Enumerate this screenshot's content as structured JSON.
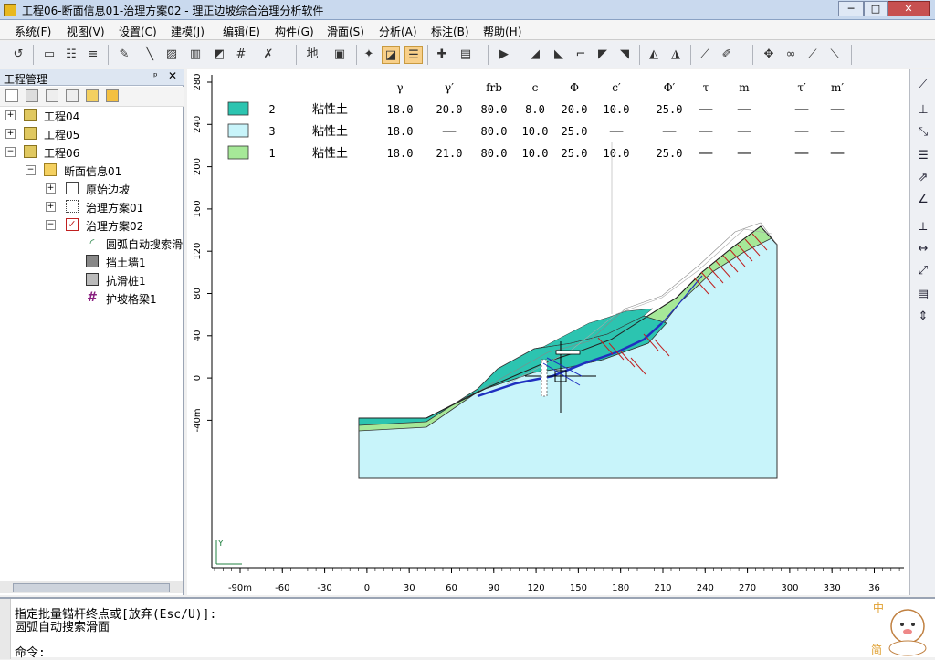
{
  "window": {
    "title": "工程06-断面信息01-治理方案02 - 理正边坡综合治理分析软件",
    "min": "─",
    "max": "□",
    "close": "✕"
  },
  "menus": [
    "系统(F)",
    "视图(V)",
    "设置(C)",
    "建模(J)",
    "编辑(E)",
    "构件(G)",
    "滑面(S)",
    "分析(A)",
    "标注(B)",
    "帮助(H)"
  ],
  "toolbar_label": "地",
  "panel": {
    "title": "工程管理",
    "pin": "ᵖ",
    "close": "✕"
  },
  "tree": {
    "p04": "工程04",
    "p05": "工程05",
    "p06": "工程06",
    "sec": "断面信息01",
    "orig": "原始边坡",
    "plan1": "治理方案01",
    "plan2": "治理方案02",
    "arc": "圆弧自动搜索滑",
    "wall": "挡土墙1",
    "pile": "抗滑桩1",
    "beam": "护坡格梁1"
  },
  "icons": {
    "expand": "plus-box-icon",
    "collapse": "minus-box-icon"
  },
  "legend": {
    "headers": [
      "γ",
      "γ′",
      "frb",
      "c",
      "Φ",
      "c′",
      "Φ′",
      "τ",
      "m",
      "τ′",
      "m′"
    ],
    "rows": [
      {
        "color": "#2cc4b0",
        "id": "2",
        "name": "粘性土",
        "vals": [
          "18.0",
          "20.0",
          "80.0",
          "8.0",
          "20.0",
          "10.0",
          "25.0",
          "──",
          "──",
          "──",
          "──"
        ]
      },
      {
        "color": "#c8f4fa",
        "id": "3",
        "name": "粘性土",
        "vals": [
          "18.0",
          "──",
          "80.0",
          "10.0",
          "25.0",
          "──",
          "──",
          "──",
          "──",
          "──",
          "──"
        ]
      },
      {
        "color": "#a6e898",
        "id": "1",
        "name": "粘性土",
        "vals": [
          "18.0",
          "21.0",
          "80.0",
          "10.0",
          "25.0",
          "10.0",
          "25.0",
          "──",
          "──",
          "──",
          "──"
        ]
      }
    ]
  },
  "axis": {
    "y_ticks": [
      "280",
      "240",
      "200",
      "160",
      "120",
      "80",
      "40",
      "0",
      "-40m"
    ],
    "x_ticks": [
      "-90m",
      "-60",
      "-30",
      "0",
      "30",
      "60",
      "90",
      "120",
      "150",
      "180",
      "210",
      "240",
      "270",
      "300",
      "330",
      "36"
    ],
    "origin_y": "Y"
  },
  "command": {
    "line1": "指定批量锚杆终点或[放弃(Esc/U)]:",
    "line2": "圆弧自动搜索滑面",
    "prompt": "命令:"
  },
  "mascot_text": [
    "中",
    "简"
  ]
}
